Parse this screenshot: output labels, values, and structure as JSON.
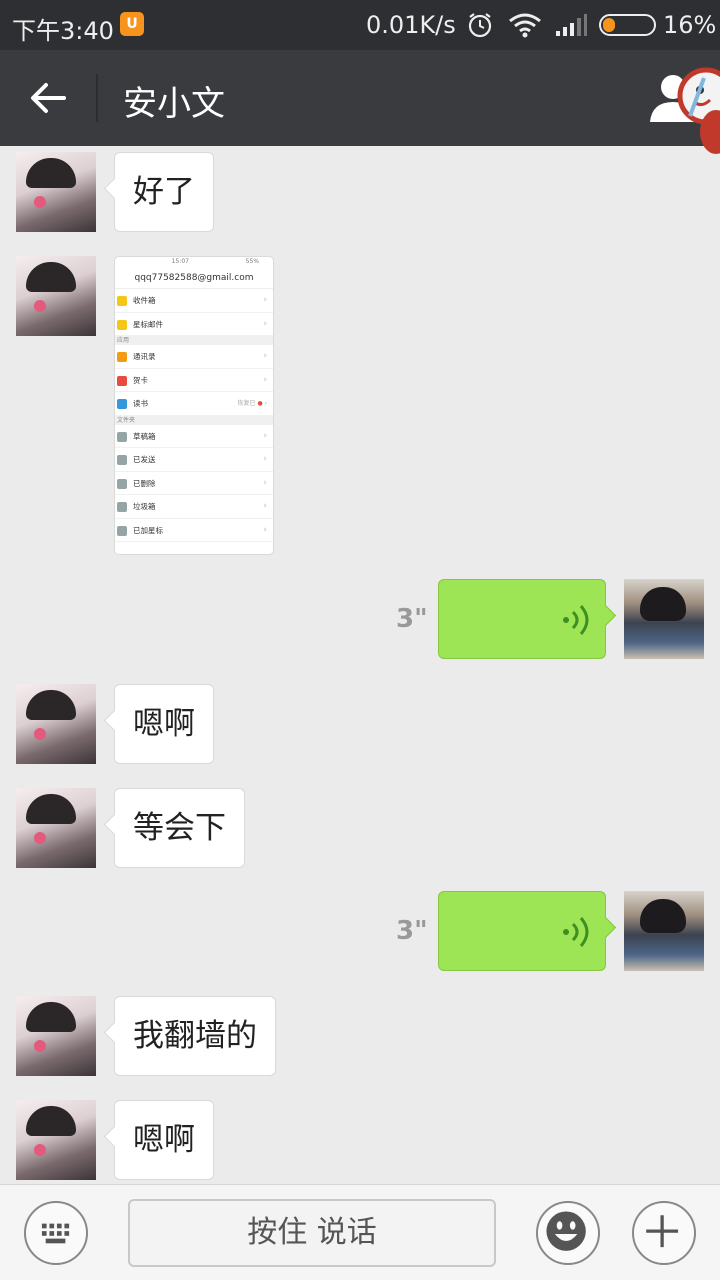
{
  "status_bar": {
    "time": "下午3:40",
    "network_speed": "0.01K/s",
    "battery_percent": "16%",
    "battery_level": 0.16,
    "icons": [
      "uc-browser-icon",
      "alarm-icon",
      "wifi-icon",
      "signal-icon",
      "battery-icon"
    ]
  },
  "header": {
    "title": "安小文",
    "back_icon": "arrow-left-icon",
    "profile_icon": "person-icon"
  },
  "messages": [
    {
      "sender": "friend",
      "type": "text",
      "text": "好了"
    },
    {
      "sender": "friend",
      "type": "image",
      "image": {
        "status_time": "15:07",
        "status_battery": "55%",
        "account": "qqq77582588@gmail.com",
        "sections": [
          {
            "header": "",
            "items": [
              "收件箱",
              "星标邮件"
            ]
          },
          {
            "header": "应用",
            "items": [
              "通讯录",
              "贺卡",
              "读书"
            ]
          },
          {
            "header": "文件夹",
            "items": [
              "草稿箱",
              "已发送",
              "已删除",
              "垃圾箱",
              "已加星标"
            ]
          }
        ],
        "reading_extra": "恢复已"
      }
    },
    {
      "sender": "me",
      "type": "voice",
      "duration": "3\""
    },
    {
      "sender": "friend",
      "type": "text",
      "text": "嗯啊"
    },
    {
      "sender": "friend",
      "type": "text",
      "text": "等会下"
    },
    {
      "sender": "me",
      "type": "voice",
      "duration": "3\""
    },
    {
      "sender": "friend",
      "type": "text",
      "text": "我翻墙的"
    },
    {
      "sender": "friend",
      "type": "text",
      "text": "嗯啊"
    }
  ],
  "input_bar": {
    "hold_to_talk_label": "按住 说话",
    "keyboard_icon": "keyboard-icon",
    "emoji_icon": "smiley-icon",
    "plus_icon": "plus-icon"
  },
  "colors": {
    "title_bar": "#3a3b3f",
    "voice_bubble": "#9ee556",
    "chat_background": "#ebebeb"
  }
}
